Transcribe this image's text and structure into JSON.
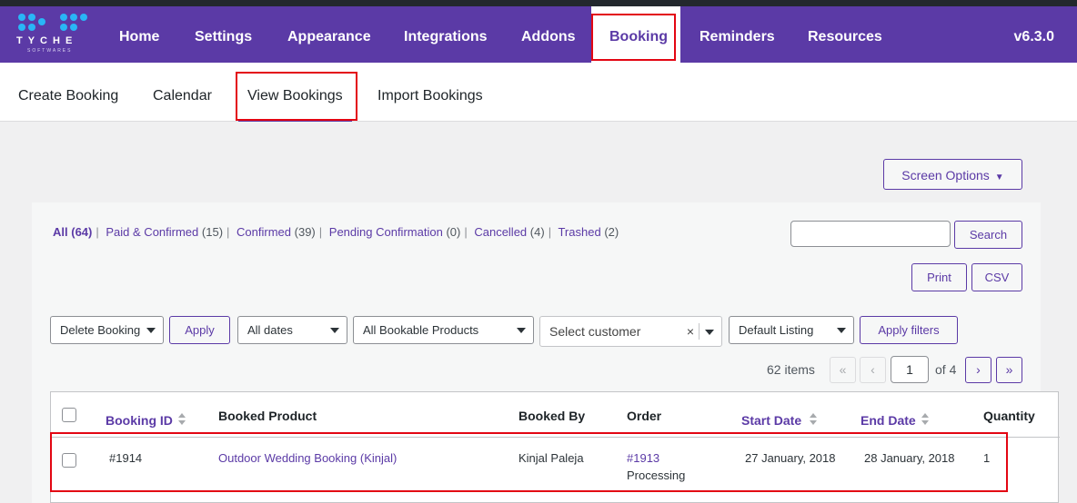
{
  "brand": {
    "name": "TYCHE",
    "sub": "SOFTWARES"
  },
  "topnav": {
    "items": [
      {
        "label": "Home"
      },
      {
        "label": "Settings"
      },
      {
        "label": "Appearance"
      },
      {
        "label": "Integrations"
      },
      {
        "label": "Addons"
      },
      {
        "label": "Booking",
        "active": true
      },
      {
        "label": "Reminders"
      },
      {
        "label": "Resources"
      }
    ],
    "version": "v6.3.0"
  },
  "subnav": {
    "items": [
      {
        "label": "Create Booking"
      },
      {
        "label": "Calendar"
      },
      {
        "label": "View Bookings",
        "active": true
      },
      {
        "label": "Import Bookings"
      }
    ]
  },
  "screen_options": {
    "label": "Screen Options"
  },
  "views": [
    {
      "label": "All",
      "count": "(64)",
      "current": true
    },
    {
      "label": "Paid & Confirmed",
      "count": "(15)"
    },
    {
      "label": "Confirmed",
      "count": "(39)"
    },
    {
      "label": "Pending Confirmation",
      "count": "(0)"
    },
    {
      "label": "Cancelled",
      "count": "(4)"
    },
    {
      "label": "Trashed",
      "count": "(2)"
    }
  ],
  "search": {
    "value": "",
    "button": "Search"
  },
  "export": {
    "print": "Print",
    "csv": "CSV"
  },
  "filters": {
    "bulk_action": "Delete Booking",
    "apply": "Apply",
    "dates": "All dates",
    "products": "All Bookable Products",
    "customer": "Select customer",
    "customer_clear": "×",
    "listing": "Default Listing",
    "apply_filters": "Apply filters"
  },
  "pagination": {
    "items": "62 items",
    "first": "«",
    "prev": "‹",
    "current": "1",
    "of": "of 4",
    "next": "›",
    "last": "»"
  },
  "table": {
    "headers": {
      "booking_id": "Booking ID",
      "product": "Booked Product",
      "booked_by": "Booked By",
      "order": "Order",
      "start": "Start Date",
      "end": "End Date",
      "qty": "Quantity"
    },
    "rows": [
      {
        "id": "#1914",
        "product": "Outdoor Wedding Booking (Kinjal)",
        "booked_by": "Kinjal Paleja",
        "order": "#1913",
        "order_status": "Processing",
        "start": "27 January, 2018",
        "end": "28 January, 2018",
        "qty": "1"
      }
    ]
  },
  "colors": {
    "brand": "#5b3aa6",
    "highlight": "#e30613",
    "logo_dot": "#29b6f6"
  }
}
